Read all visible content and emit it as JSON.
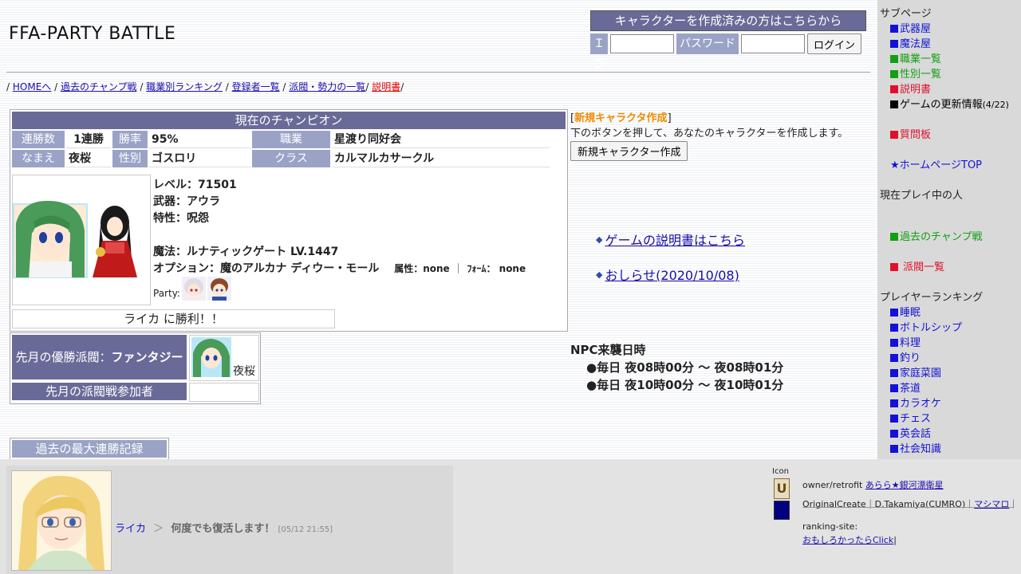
{
  "site": {
    "title": "FFA-PARTY BATTLE"
  },
  "login": {
    "header": "キャラクターを作成済みの方はこちらから",
    "id_label": "ＩＤ",
    "password_label": "パスワード",
    "id_value": "",
    "password_value": "",
    "button": "ログイン"
  },
  "nav": {
    "sep": "/",
    "items": [
      "HOMEへ",
      "過去のチャンプ戦",
      "職業別ランキング",
      "登録者一覧",
      "派閥・勢力の一覧",
      "説明書"
    ]
  },
  "champion": {
    "header": "現在のチャンピオン",
    "streak_label": "連勝数",
    "streak": "1連勝",
    "winrate_label": "勝率",
    "winrate": "95%",
    "job_label": "職業",
    "job": "星渡り同好会",
    "name_label": "なまえ",
    "name": "夜桜",
    "gender_label": "性別",
    "gender": "ゴスロリ",
    "class_label": "クラス",
    "class": "カルマルカサークル",
    "level": "レベル：71501",
    "weapon": "武器：アウラ",
    "trait": "特性：呪怨",
    "magic": "魔法：ルナティックゲート LV.1447",
    "option": "オプション：魔のアルカナ ディウー・モール",
    "attribute": "属性：none",
    "form": "ﾌｫｰﾑ： none",
    "party_label": "Party:",
    "result": "ライカ に勝利！！"
  },
  "faction": {
    "winner_label": "先月の優勝派閥：",
    "winner": "ファンタジー",
    "winner_char": "夜桜",
    "participants_label": "先月の派閥戦参加者"
  },
  "record": {
    "label": "過去の最大連勝記録"
  },
  "new_char": {
    "bracket_open": "[",
    "title": "新規キャラクタ作成",
    "bracket_close": "]",
    "desc": "下のボタンを押して、あなたのキャラクターを作成します。",
    "button": "新規キャラクター作成"
  },
  "links": {
    "manual": "ゲームの説明書はこちら",
    "news": "おしらせ(2020/10/08)"
  },
  "npc": {
    "title": "NPC来襲日時",
    "time1": "●毎日 夜08時00分 〜 夜08時01分",
    "time2": "●毎日 夜10時00分 〜 夜10時01分"
  },
  "sidebar": {
    "subpage_title": "サブページ",
    "subpages": [
      {
        "label": "武器屋",
        "color": "#1212d6"
      },
      {
        "label": "魔法屋",
        "color": "#1212d6"
      },
      {
        "label": "職業一覧",
        "color": "#12a012"
      },
      {
        "label": "性別一覧",
        "color": "#12a012"
      },
      {
        "label": "説明書",
        "color": "#e0102a"
      },
      {
        "label": "ゲームの更新情報",
        "suffix": "(4/22)",
        "color": "#000000"
      }
    ],
    "bbs": "質問板",
    "home": "★ホームページTOP",
    "playing_title": "現在プレイ中の人",
    "past_champ": "過去のチャンプ戦",
    "faction_list": " 派閥一覧",
    "ranking_title": "プレイヤーランキング",
    "rankings": [
      "睡眠",
      "ボトルシップ",
      "料理",
      "釣り",
      "家庭菜園",
      "茶道",
      "カラオケ",
      "チェス",
      "英会話",
      "社会知識"
    ]
  },
  "chat": {
    "name": "ライカ",
    "arrow": "＞",
    "message": "何度でも復活します！",
    "time": "[05/12 21:55]"
  },
  "credits": {
    "icon_label": "Icon",
    "owner_label": "owner/retrofit",
    "owner_link": "あらら★銀河漂衛星",
    "original_label": "OriginalCreate｜D.Takamiya(CUMRO)｜",
    "original_link": "マシマロ",
    "original_end": "｜",
    "ranking_label": "ranking-site:",
    "ranking_link": "おもしろかったらClick",
    "ranking_end": "|"
  }
}
